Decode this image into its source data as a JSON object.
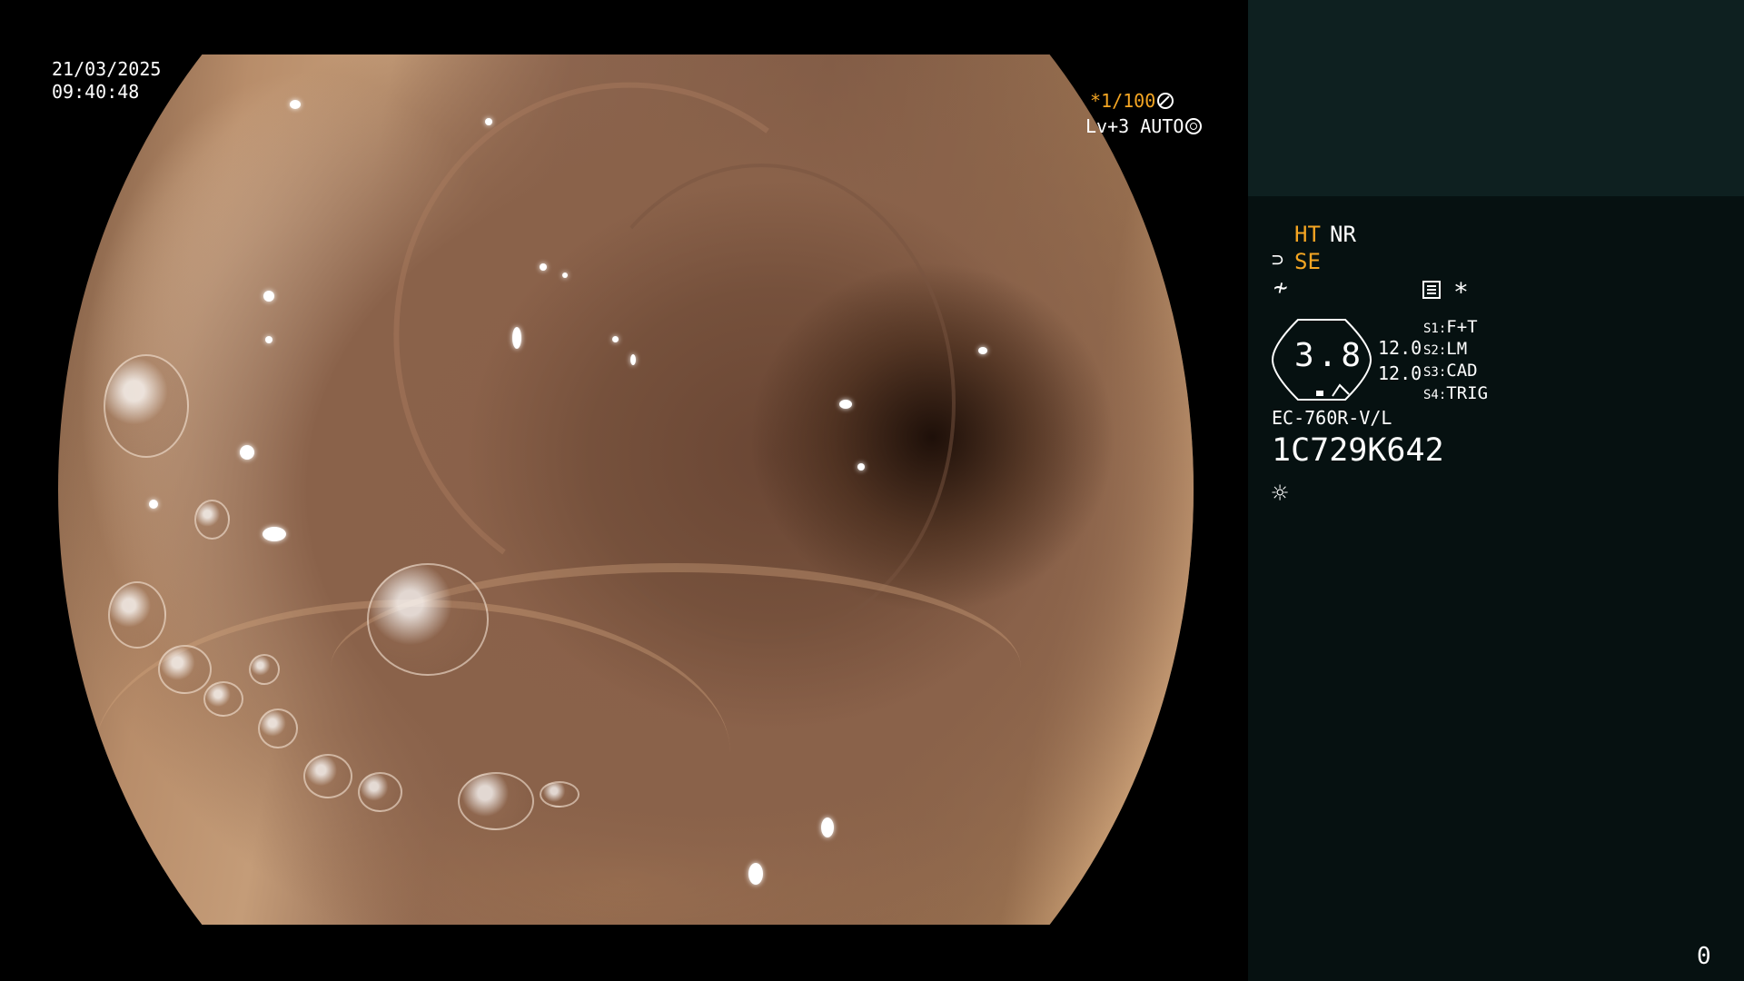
{
  "overlay": {
    "date": "21/03/2025",
    "time": "09:40:48",
    "shutter": "*1/100",
    "shutter_icon": "aperture-icon",
    "level": "Lv+3 AUTO",
    "level_icon": "iris-icon"
  },
  "panel": {
    "ht": "HT",
    "nr": "NR",
    "se_icon": "⊃",
    "se": "SE",
    "ne_icon": "≁",
    "asterisk": "*",
    "gauge_value": "3.8",
    "gauge_a": "12.0",
    "gauge_b": "12.0",
    "switches": [
      {
        "key": "S1:",
        "value": "F+T"
      },
      {
        "key": "S2:",
        "value": "LM"
      },
      {
        "key": "S3:",
        "value": "CAD"
      },
      {
        "key": "S4:",
        "value": "TRIG"
      }
    ],
    "model": "EC-760R-V/L",
    "serial": "1C729K642",
    "light_icon": "☼",
    "counter": "0"
  },
  "colors": {
    "accent_orange": "#f5a623",
    "panel_top": "#0e2020",
    "panel_bottom": "#061111"
  }
}
